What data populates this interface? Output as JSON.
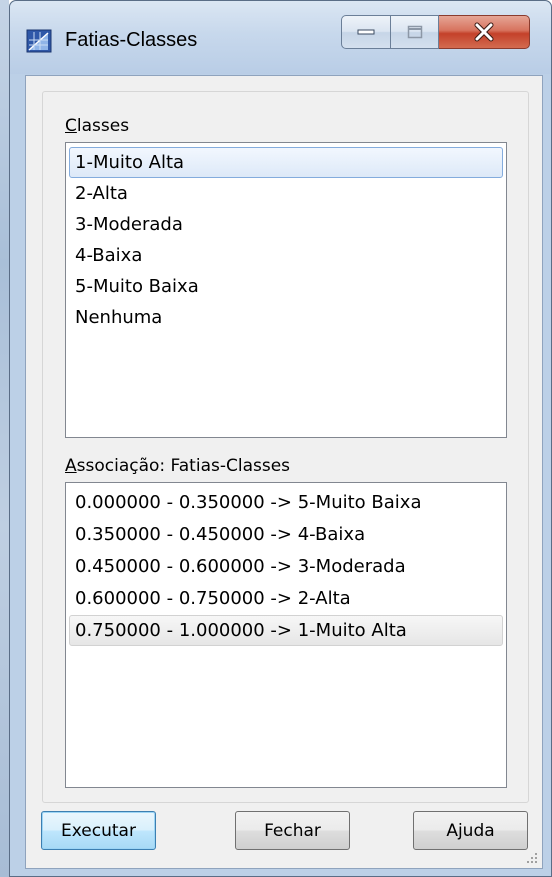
{
  "window": {
    "title": "Fatias-Classes",
    "controls": {
      "minimize_icon": "minimize-icon",
      "maximize_icon": "maximize-icon",
      "close_icon": "close-icon"
    }
  },
  "classes": {
    "label_accel": "C",
    "label_rest": "lasses",
    "items": [
      "1-Muito Alta",
      "2-Alta",
      "3-Moderada",
      "4-Baixa",
      "5-Muito Baixa",
      "Nenhuma"
    ],
    "selected_index": 0
  },
  "association": {
    "label_accel": "A",
    "label_rest": "ssociação: Fatias-Classes",
    "items": [
      "0.000000 - 0.350000 -> 5-Muito Baixa",
      "0.350000 - 0.450000 -> 4-Baixa",
      "0.450000 - 0.600000 -> 3-Moderada",
      "0.600000 - 0.750000 -> 2-Alta",
      "0.750000 - 1.000000 -> 1-Muito Alta"
    ],
    "selected_index": 4
  },
  "buttons": {
    "execute": "Executar",
    "close": "Fechar",
    "help": "Ajuda"
  },
  "colors": {
    "accent": "#3c7fb1",
    "close_button": "#c4412a"
  }
}
